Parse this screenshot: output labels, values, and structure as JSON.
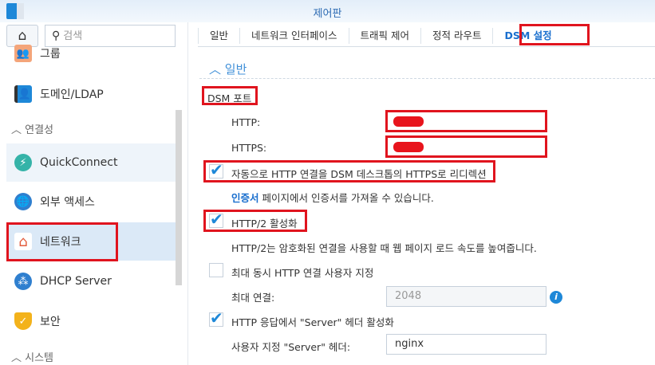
{
  "window": {
    "title": "제어판"
  },
  "sidebar": {
    "search_placeholder": "검색",
    "items": [
      {
        "label": "그룹",
        "icon": "group-icon"
      },
      {
        "label": "도메인/LDAP",
        "icon": "domain-ldap-icon"
      },
      {
        "label": "QuickConnect",
        "icon": "quickconnect-icon"
      },
      {
        "label": "외부 액세스",
        "icon": "external-access-icon"
      },
      {
        "label": "네트워크",
        "icon": "network-icon"
      },
      {
        "label": "DHCP Server",
        "icon": "dhcp-server-icon"
      },
      {
        "label": "보안",
        "icon": "security-icon"
      }
    ],
    "groups": [
      "연결성",
      "시스템"
    ]
  },
  "tabs": [
    "일반",
    "네트워크 인터페이스",
    "트래픽 제어",
    "정적 라우트",
    "DSM 설정"
  ],
  "active_tab": "DSM 설정",
  "section": {
    "title": "일반"
  },
  "form": {
    "dsm_port_label": "DSM 포트",
    "http_label": "HTTP:",
    "https_label": "HTTPS:",
    "redirect_label": "자동으로 HTTP 연결을 DSM 데스크톱의 HTTPS로 리디렉션",
    "cert_link": "인증서",
    "cert_text": " 페이지에서 인증서를 가져올 수 있습니다.",
    "http2_label": "HTTP/2 활성화",
    "http2_desc": "HTTP/2는 암호화된 연결을 사용할 때 웹 페이지 로드 속도를 높여줍니다.",
    "max_conn_check_label": "최대 동시 HTTP 연결 사용자 지정",
    "max_conn_label": "최대 연결:",
    "max_conn_value": "2048",
    "server_header_check_label": "HTTP 응답에서 \"Server\" 헤더 활성화",
    "custom_server_label": "사용자 지정 \"Server\" 헤더:",
    "custom_server_value": "nginx"
  },
  "colors": {
    "accent": "#1a6fce",
    "highlight": "#e0141e"
  }
}
